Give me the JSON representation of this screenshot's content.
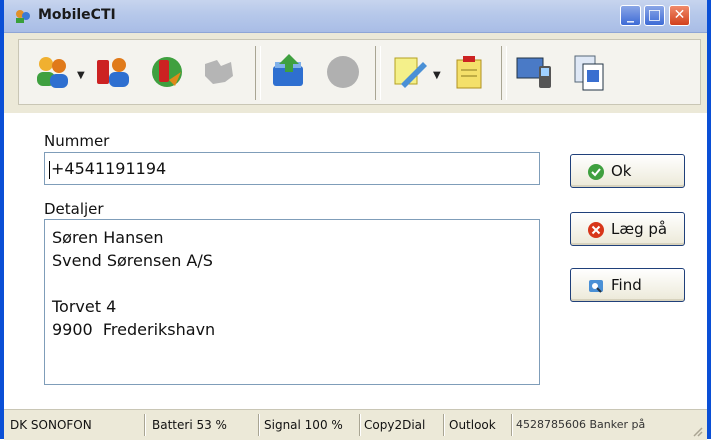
{
  "window": {
    "title": "MobileCTI",
    "controls": {
      "minimize": "_",
      "maximize": "□",
      "close": "✕"
    }
  },
  "toolbar": {
    "icons": [
      "contacts-dropdown-icon",
      "mobile-contact-icon",
      "phone-redirect-icon",
      "disabled-puzzle-icon",
      "inbox-upload-icon",
      "disabled-circle-icon",
      "notes-edit-icon",
      "clipboard-note-icon",
      "device-sync-icon",
      "copy-pages-icon"
    ]
  },
  "form": {
    "number_label": "Nummer",
    "number_value": "+4541191194",
    "details_label": "Detaljer",
    "details_lines": [
      "Søren Hansen",
      "Svend Sørensen A/S",
      "",
      "Torvet 4",
      "9900  Frederikshavn"
    ]
  },
  "buttons": {
    "ok": "Ok",
    "hangup": "Læg på",
    "find": "Find"
  },
  "statusbar": {
    "operator": "DK SONOFON",
    "battery": "Batteri 53 %",
    "signal": "Signal 100 %",
    "copy2dial": "Copy2Dial",
    "outlook": "Outlook",
    "call_status": "4528785606 Banker på"
  },
  "colors": {
    "titlebar": "#b6c8ea",
    "window_border": "#0a4fd6",
    "toolbar_bg": "#ece9d8",
    "field_border": "#7f9db9"
  }
}
